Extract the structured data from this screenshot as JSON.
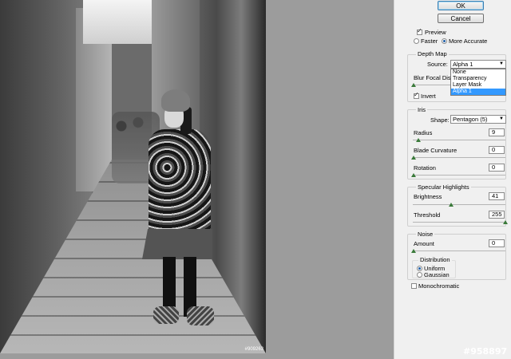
{
  "dialog": {
    "ok_label": "OK",
    "cancel_label": "Cancel",
    "preview_label": "Preview",
    "preview_checked": true,
    "faster_label": "Faster",
    "more_accurate_label": "More Accurate",
    "quality_selected": "More Accurate"
  },
  "depth_map": {
    "title": "Depth Map",
    "source_label": "Source:",
    "source_value": "Alpha 1",
    "source_options": [
      "None",
      "Transparency",
      "Layer Mask",
      "Alpha 1"
    ],
    "blur_focal_label": "Blur Focal Dista",
    "invert_label": "Invert",
    "invert_checked": true
  },
  "iris": {
    "title": "Iris",
    "shape_label": "Shape:",
    "shape_value": "Pentagon (5)",
    "radius_label": "Radius",
    "radius_value": "9",
    "blade_curvature_label": "Blade Curvature",
    "blade_curvature_value": "0",
    "rotation_label": "Rotation",
    "rotation_value": "0"
  },
  "specular": {
    "title": "Specular Highlights",
    "brightness_label": "Brightness",
    "brightness_value": "41",
    "threshold_label": "Threshold",
    "threshold_value": "255"
  },
  "noise": {
    "title": "Noise",
    "amount_label": "Amount",
    "amount_value": "0",
    "distribution_title": "Distribution",
    "uniform_label": "Uniform",
    "gaussian_label": "Gaussian",
    "distribution_selected": "Uniform",
    "monochromatic_label": "Monochromatic",
    "monochromatic_checked": false
  },
  "image": {
    "watermark": "#909263"
  },
  "badge": "#958897"
}
